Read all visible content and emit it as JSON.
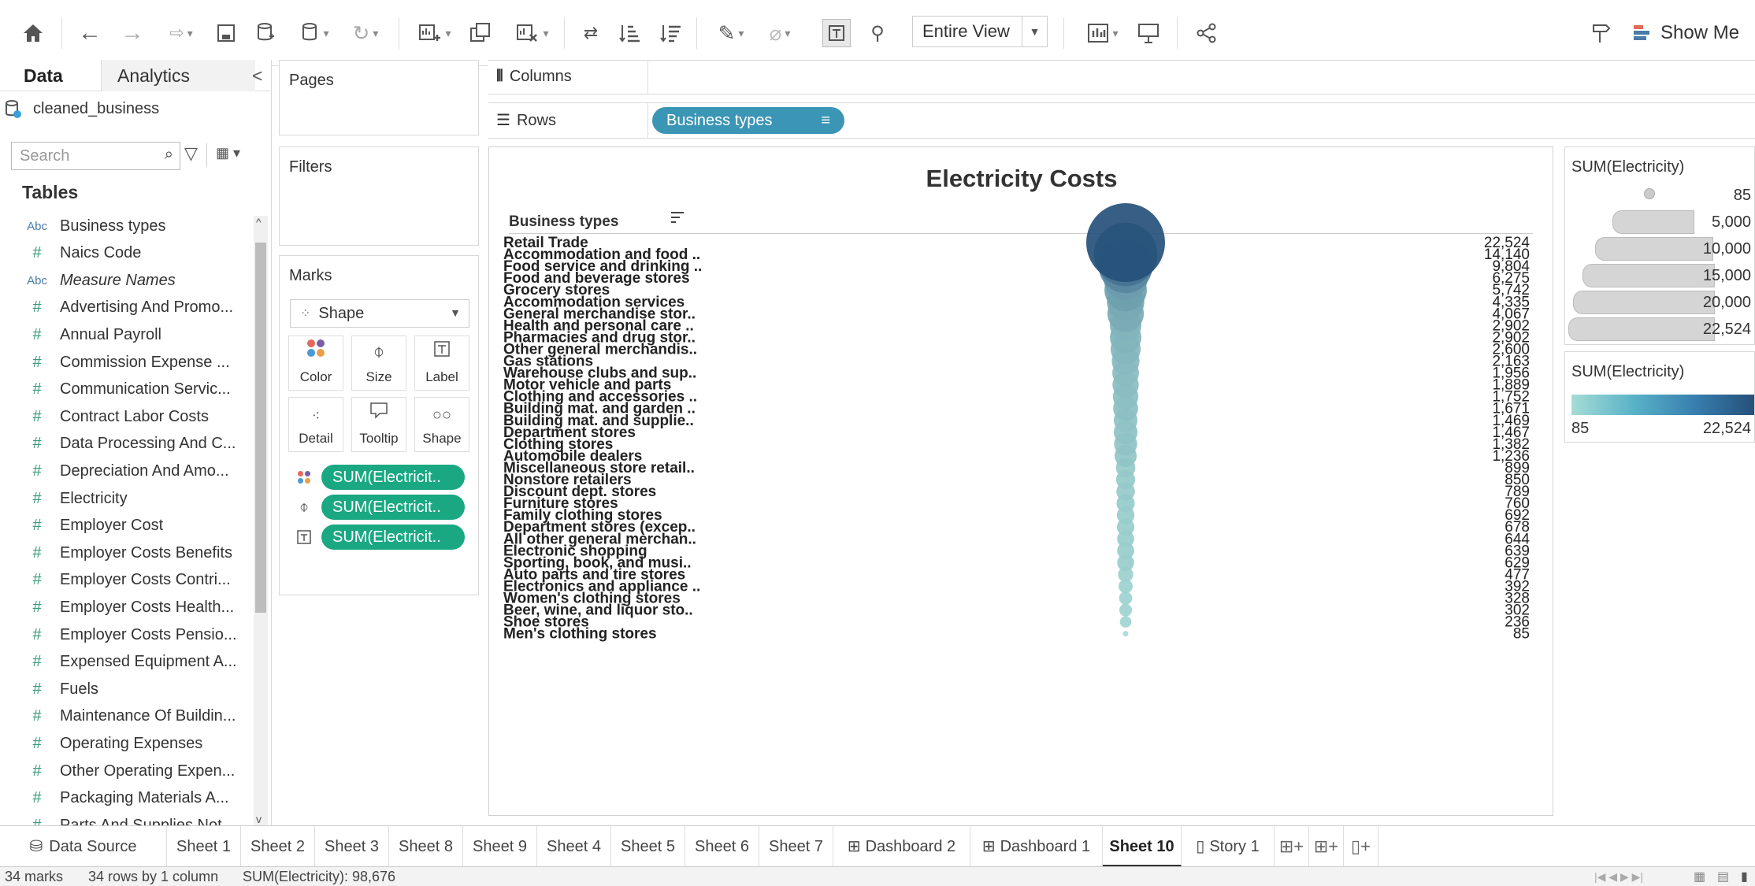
{
  "toolbar": {
    "entire_view": "Entire View",
    "show_me": "Show Me"
  },
  "data_pane": {
    "tab_data": "Data",
    "tab_analytics": "Analytics",
    "collapse": "<",
    "datasource": "cleaned_business",
    "search_placeholder": "Search",
    "tables_heading": "Tables",
    "fields": [
      {
        "type": "Abc",
        "name": "Business types"
      },
      {
        "type": "#",
        "name": "Naics Code"
      },
      {
        "type": "Abc",
        "name": "Measure Names"
      },
      {
        "type": "#",
        "name": "Advertising And Promo..."
      },
      {
        "type": "#",
        "name": "Annual Payroll"
      },
      {
        "type": "#",
        "name": "Commission Expense ..."
      },
      {
        "type": "#",
        "name": "Communication Servic..."
      },
      {
        "type": "#",
        "name": "Contract Labor Costs"
      },
      {
        "type": "#",
        "name": "Data Processing And C..."
      },
      {
        "type": "#",
        "name": "Depreciation And Amo..."
      },
      {
        "type": "#",
        "name": "Electricity"
      },
      {
        "type": "#",
        "name": "Employer Cost"
      },
      {
        "type": "#",
        "name": "Employer Costs Benefits"
      },
      {
        "type": "#",
        "name": "Employer Costs Contri..."
      },
      {
        "type": "#",
        "name": "Employer Costs Health..."
      },
      {
        "type": "#",
        "name": "Employer Costs Pensio..."
      },
      {
        "type": "#",
        "name": "Expensed Equipment A..."
      },
      {
        "type": "#",
        "name": "Fuels"
      },
      {
        "type": "#",
        "name": "Maintenance Of Buildin..."
      },
      {
        "type": "#",
        "name": "Operating Expenses"
      },
      {
        "type": "#",
        "name": "Other Operating Expen..."
      },
      {
        "type": "#",
        "name": "Packaging Materials A..."
      },
      {
        "type": "#",
        "name": "Parts And Supplies Not..."
      }
    ]
  },
  "cards": {
    "pages": "Pages",
    "filters": "Filters",
    "marks": "Marks",
    "mark_type": "Shape",
    "mark_buttons": [
      "Color",
      "Size",
      "Label",
      "Detail",
      "Tooltip",
      "Shape"
    ],
    "pills": [
      "SUM(Electricit..",
      "SUM(Electricit..",
      "SUM(Electricit.."
    ]
  },
  "shelves": {
    "columns": "Columns",
    "rows": "Rows",
    "rows_pill": "Business types"
  },
  "view": {
    "title": "Electricity Costs",
    "row_header": "Business types"
  },
  "chart_data": {
    "type": "scatter",
    "title": "Electricity Costs",
    "xlabel": "",
    "ylabel": "Business types",
    "measure": "SUM(Electricity)",
    "categories": [
      "Retail Trade",
      "Accommodation and food ..",
      "Food service and drinking ..",
      "Food and beverage stores",
      "Grocery stores",
      "Accommodation services",
      "General merchandise stor..",
      "Health and personal care ..",
      "Pharmacies and drug stor..",
      "Other general merchandis..",
      "Gas stations",
      "Warehouse clubs and sup..",
      "Motor vehicle and parts",
      "Clothing and accessories ..",
      "Building mat. and garden ..",
      "Building mat. and supplie..",
      "Department stores",
      "Clothing stores",
      "Automobile dealers",
      "Miscellaneous store retail..",
      "Nonstore retailers",
      "Discount dept. stores",
      "Furniture stores",
      "Family clothing stores",
      "Department stores (excep..",
      "All other general merchan..",
      "Electronic shopping",
      "Sporting, book, and  musi..",
      "Auto parts and tire stores",
      "Electronics and appliance ..",
      "Women's clothing stores",
      "Beer, wine, and liquor sto..",
      "Shoe stores",
      "Men's clothing stores"
    ],
    "values": [
      22524,
      14140,
      9804,
      6275,
      5742,
      4335,
      4067,
      2902,
      2902,
      2600,
      2163,
      1956,
      1889,
      1752,
      1671,
      1469,
      1467,
      1382,
      1236,
      899,
      850,
      789,
      760,
      692,
      678,
      644,
      639,
      629,
      477,
      392,
      328,
      302,
      236,
      85
    ],
    "value_labels": [
      "22,524",
      "14,140",
      "9,804",
      "6,275",
      "5,742",
      "4,335",
      "4,067",
      "2,902",
      "2,902",
      "2,600",
      "2,163",
      "1,956",
      "1,889",
      "1,752",
      "1,671",
      "1,469",
      "1,467",
      "1,382",
      "1,236",
      "899",
      "850",
      "789",
      "760",
      "692",
      "678",
      "644",
      "639",
      "629",
      "477",
      "392",
      "328",
      "302",
      "236",
      "85"
    ],
    "color_min": 85,
    "color_max": 22524,
    "color_range": [
      "#a6dcd6",
      "#26507a"
    ]
  },
  "legends": {
    "size_title": "SUM(Electricity)",
    "size_values": [
      "85",
      "5,000",
      "10,000",
      "15,000",
      "20,000",
      "22,524"
    ],
    "color_title": "SUM(Electricity)",
    "color_min_label": "85",
    "color_max_label": "22,524"
  },
  "sheet_tabs": {
    "data_source": "Data Source",
    "tabs": [
      "Sheet 1",
      "Sheet 2",
      "Sheet 3",
      "Sheet 8",
      "Sheet 9",
      "Sheet 4",
      "Sheet 5",
      "Sheet 6",
      "Sheet 7",
      "Dashboard 2",
      "Dashboard 1",
      "Sheet 10",
      "Story 1"
    ],
    "active": "Sheet 10"
  },
  "status": {
    "marks": "34 marks",
    "rows_cols": "34 rows by 1 column",
    "sum": "SUM(Electricity): 98,676"
  }
}
